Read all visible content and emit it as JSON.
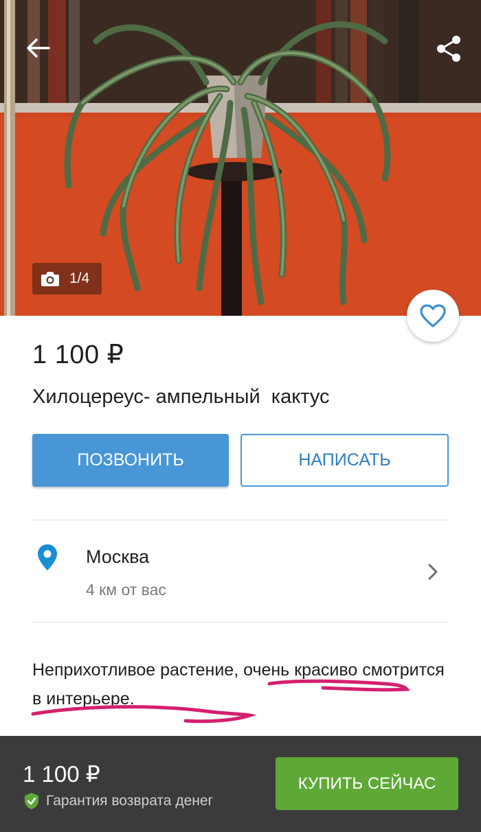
{
  "gallery": {
    "counter": "1/4"
  },
  "listing": {
    "price": "1 100 ₽",
    "title": "Хилоцереус- ампельный  кактус"
  },
  "actions": {
    "call_label": "ПОЗВОНИТЬ",
    "write_label": "НАПИСАТЬ"
  },
  "location": {
    "city": "Москва",
    "distance": "4 км от вас"
  },
  "description": {
    "text": "Неприхотливое растение, очень красиво смотрится в интерьере."
  },
  "bottom_bar": {
    "price": "1 100 ₽",
    "guarantee": "Гарантия возврата денег",
    "buy_label": "КУПИТЬ СЕЙЧАС"
  },
  "colors": {
    "primary_blue": "#4896d6",
    "buy_green": "#5ea936",
    "pin_blue": "#1a8fd0",
    "shield_green": "#5ea936",
    "bottom_bar_bg": "#3b3b3b",
    "underline_magenta": "#d4206e"
  },
  "icons": {
    "back": "arrow-left-icon",
    "share": "share-icon",
    "camera": "camera-icon",
    "favorite": "heart-outline-icon",
    "location": "map-pin-icon",
    "chevron": "chevron-right-icon",
    "guarantee": "shield-check-icon"
  }
}
